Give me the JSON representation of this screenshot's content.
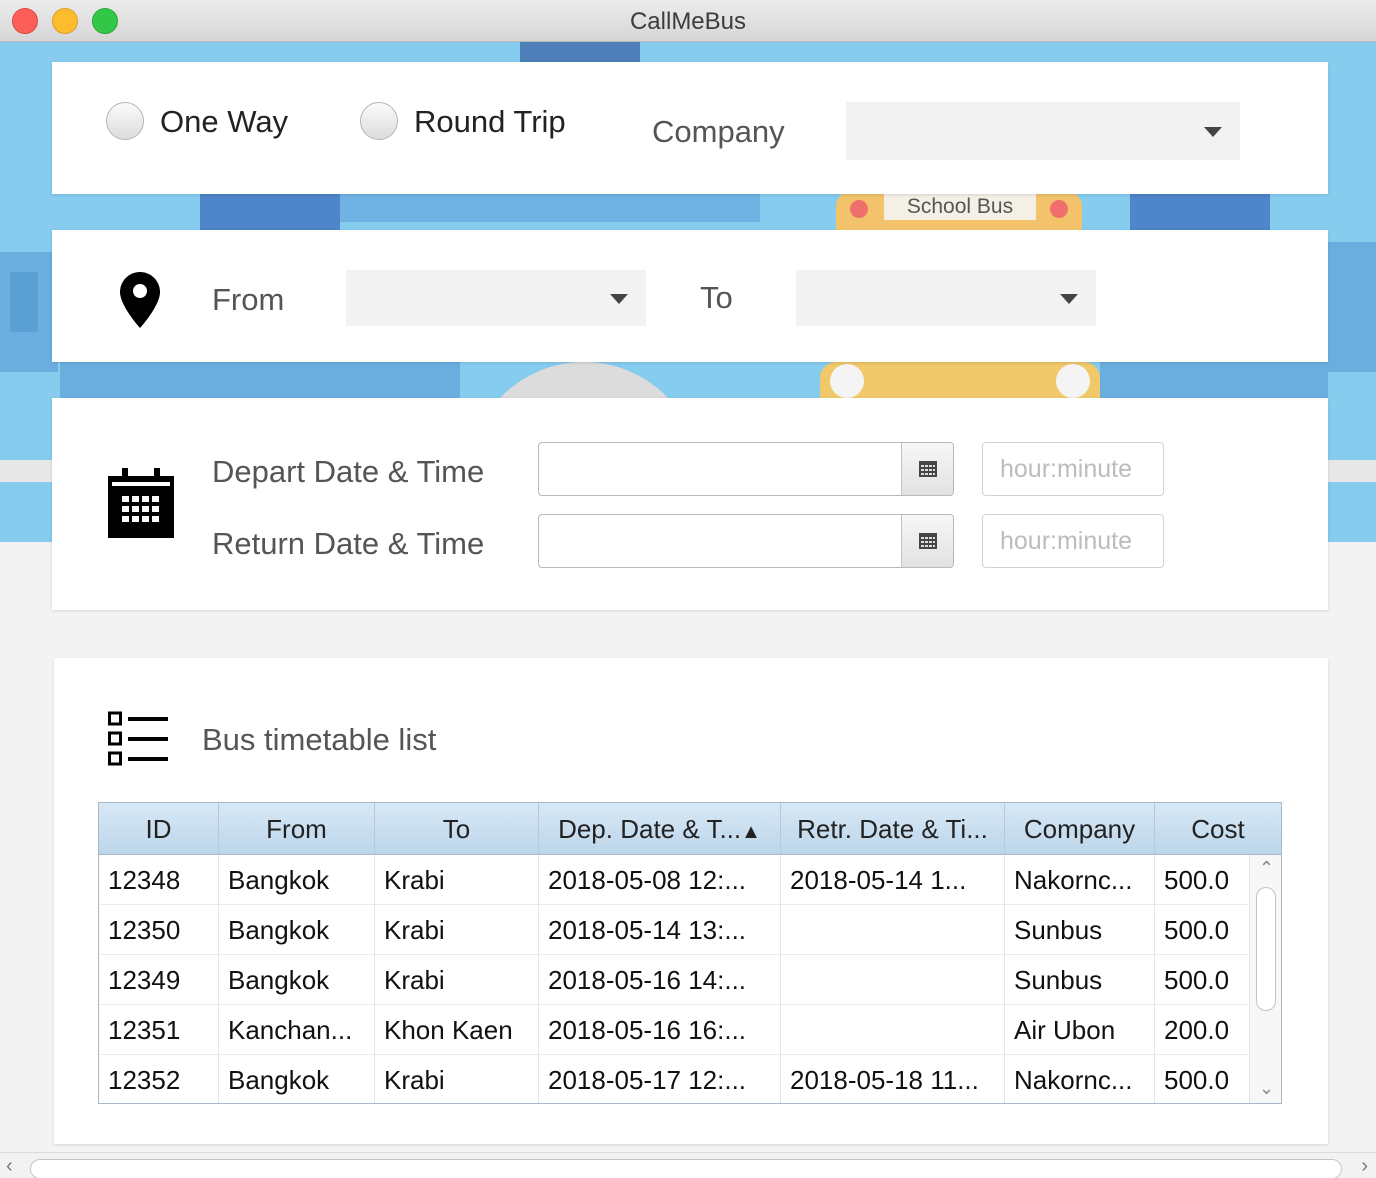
{
  "window": {
    "title": "CallMeBus"
  },
  "trip": {
    "one_way_label": "One Way",
    "round_trip_label": "Round Trip",
    "company_label": "Company",
    "company_value": ""
  },
  "route": {
    "from_label": "From",
    "from_value": "",
    "to_label": "To",
    "to_value": ""
  },
  "dates": {
    "depart_label": "Depart Date & Time",
    "return_label": "Return Date & Time",
    "depart_date": "",
    "return_date": "",
    "depart_time_placeholder": "hour:minute",
    "return_time_placeholder": "hour:minute"
  },
  "background": {
    "sign_text": "School Bus"
  },
  "timetable": {
    "title": "Bus timetable list",
    "columns": [
      "ID",
      "From",
      "To",
      "Dep. Date & T...",
      "Retr. Date & Ti...",
      "Company",
      "Cost"
    ],
    "sort_indicator": "▲",
    "rows": [
      [
        "12348",
        "Bangkok",
        "Krabi",
        "2018-05-08 12:...",
        "2018-05-14 1...",
        "Nakornc...",
        "500.0"
      ],
      [
        "12350",
        "Bangkok",
        "Krabi",
        "2018-05-14 13:...",
        "",
        "Sunbus",
        "500.0"
      ],
      [
        "12349",
        "Bangkok",
        "Krabi",
        "2018-05-16 14:...",
        "",
        "Sunbus",
        "500.0"
      ],
      [
        "12351",
        "Kanchan...",
        "Khon Kaen",
        "2018-05-16 16:...",
        "",
        "Air Ubon",
        "200.0"
      ],
      [
        "12352",
        "Bangkok",
        "Krabi",
        "2018-05-17 12:...",
        "2018-05-18 11...",
        "Nakornc...",
        "500.0"
      ]
    ]
  },
  "colors": {
    "sky": "#86ccef",
    "header_blue": "#cfe2f3",
    "card": "#ffffff"
  },
  "icons": {
    "location": "map-pin-icon",
    "calendar": "calendar-icon",
    "list": "list-icon"
  }
}
